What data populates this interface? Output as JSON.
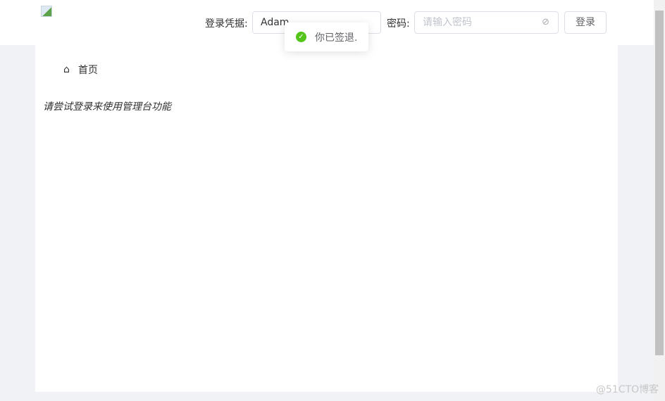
{
  "header": {
    "credential_label": "登录凭据:",
    "credential_value": "Adam",
    "password_label": "密码:",
    "password_placeholder": "请输入密码",
    "login_button": "登录"
  },
  "breadcrumb": {
    "home": "首页"
  },
  "main": {
    "hint": "请尝试登录来使用管理台功能"
  },
  "toast": {
    "message": "你已签退.",
    "type": "success"
  },
  "watermark": "@51CTO博客"
}
